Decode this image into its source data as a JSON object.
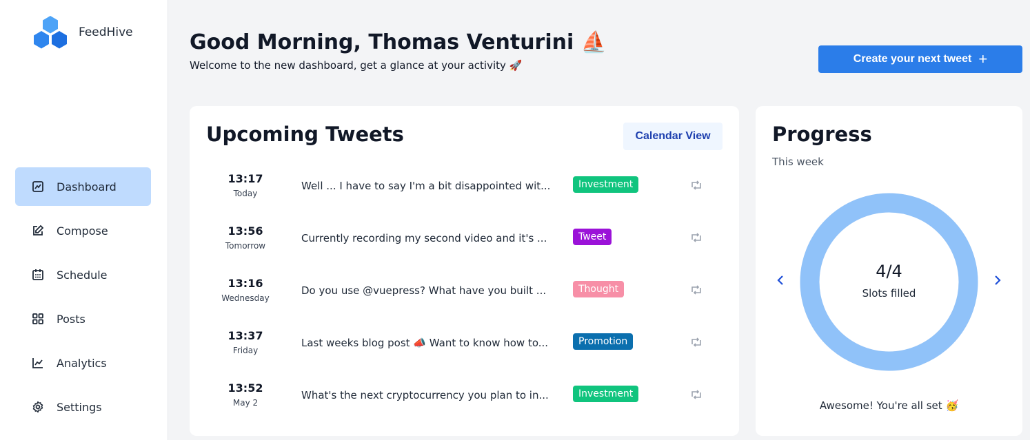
{
  "brand": {
    "name": "FeedHive",
    "colors": {
      "logo_light": "#4da3f7",
      "logo_dark": "#1d6fe0"
    }
  },
  "sidebar": {
    "items": [
      {
        "label": "Dashboard",
        "icon": "chart-square-icon",
        "active": true
      },
      {
        "label": "Compose",
        "icon": "edit-icon"
      },
      {
        "label": "Schedule",
        "icon": "calendar-icon"
      },
      {
        "label": "Posts",
        "icon": "grid-icon"
      },
      {
        "label": "Analytics",
        "icon": "line-chart-icon"
      },
      {
        "label": "Settings",
        "icon": "gear-icon"
      }
    ]
  },
  "header": {
    "greeting": "Good Morning, Thomas Venturini ⛵",
    "subtitle": "Welcome to the new dashboard, get a glance at your activity 🚀",
    "create_button": "Create your next tweet",
    "create_button_icon": "plus-icon",
    "accent": "#2b7de9"
  },
  "upcoming": {
    "title": "Upcoming Tweets",
    "calendar_button": "Calendar View",
    "rows": [
      {
        "time": "13:17",
        "day": "Today",
        "text": "Well ... I have to say I'm a bit disappointed wit...",
        "tag": "Investment",
        "tag_color": "#10c47e"
      },
      {
        "time": "13:56",
        "day": "Tomorrow",
        "text": "Currently recording my second video and it's ...",
        "tag": "Tweet",
        "tag_color": "#9b12d8"
      },
      {
        "time": "13:16",
        "day": "Wednesday",
        "text": "Do you use @vuepress? What have you built ...",
        "tag": "Thought",
        "tag_color": "#f78fa7"
      },
      {
        "time": "13:37",
        "day": "Friday",
        "text": "Last weeks blog post 📣 Want to know how to...",
        "tag": "Promotion",
        "tag_color": "#0b6fae"
      },
      {
        "time": "13:52",
        "day": "May 2",
        "text": "What's the next cryptocurrency you plan to in...",
        "tag": "Investment",
        "tag_color": "#10c47e"
      }
    ]
  },
  "progress": {
    "title": "Progress",
    "period": "This week",
    "value": "4/4",
    "label": "Slots filled",
    "fraction": 1.0,
    "ring_color": "#90c2f9",
    "footer": "Awesome! You're all set 🥳"
  }
}
